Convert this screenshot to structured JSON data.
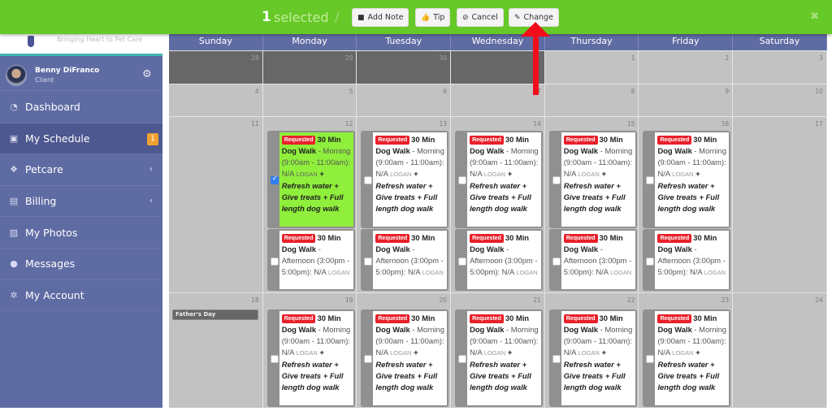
{
  "topbar": {
    "selected_count": "1",
    "selected_label": "selected",
    "separator": "/",
    "buttons": [
      {
        "label": "Add Note",
        "icon": "note-icon"
      },
      {
        "label": "Tip",
        "icon": "thumbs-up-icon"
      },
      {
        "label": "Cancel",
        "icon": "ban-icon"
      },
      {
        "label": "Change",
        "icon": "edit-icon"
      }
    ],
    "close_glyph": "✖"
  },
  "sidebar": {
    "tagline": "Bringing Heart to Pet Care",
    "user": {
      "name": "Benny DiFranco",
      "role": "Client"
    },
    "items": [
      {
        "label": "Dashboard",
        "icon": "dashboard-icon",
        "glyph": "◔"
      },
      {
        "label": "My Schedule",
        "icon": "calendar-icon",
        "glyph": "▣",
        "badge": "1",
        "active": true
      },
      {
        "label": "Petcare",
        "icon": "paw-icon",
        "glyph": "❖",
        "chevron": "‹"
      },
      {
        "label": "Billing",
        "icon": "file-icon",
        "glyph": "▤",
        "chevron": "‹"
      },
      {
        "label": "My Photos",
        "icon": "image-icon",
        "glyph": "▨"
      },
      {
        "label": "Messages",
        "icon": "comments-icon",
        "glyph": "●"
      },
      {
        "label": "My Account",
        "icon": "cogs-icon",
        "glyph": "✲"
      }
    ]
  },
  "calendar": {
    "weekdays": [
      "Sunday",
      "Monday",
      "Tuesday",
      "Wednesday",
      "Thursday",
      "Friday",
      "Saturday"
    ],
    "weeks": [
      {
        "days": [
          {
            "num": "28",
            "past": true
          },
          {
            "num": "29",
            "past": true
          },
          {
            "num": "30",
            "past": true
          },
          {
            "num": "",
            "past": true
          },
          {
            "num": "1"
          },
          {
            "num": "2"
          },
          {
            "num": "3"
          }
        ]
      },
      {
        "days": [
          {
            "num": "4"
          },
          {
            "num": "5"
          },
          {
            "num": "6"
          },
          {
            "num": "7"
          },
          {
            "num": "8"
          },
          {
            "num": "9"
          },
          {
            "num": "10"
          }
        ]
      },
      {
        "days": [
          {
            "num": "11"
          },
          {
            "num": "12"
          },
          {
            "num": "13"
          },
          {
            "num": "14"
          },
          {
            "num": "15"
          },
          {
            "num": "16"
          },
          {
            "num": "17"
          }
        ]
      },
      {
        "days": [
          {
            "num": "18",
            "holiday": "Father's Day"
          },
          {
            "num": "19"
          },
          {
            "num": "20"
          },
          {
            "num": "21"
          },
          {
            "num": "22"
          },
          {
            "num": "23"
          },
          {
            "num": "24"
          }
        ]
      }
    ],
    "event_templates": {
      "morning": {
        "status": "Requested",
        "service": "30 Min Dog Walk",
        "dash": " - ",
        "time": "Morning (9:00am - 11:00am): N/A",
        "walker": "LOGAN",
        "addons": "+ Refresh water + Give treats + Full length dog walk"
      },
      "afternoon": {
        "status": "Requested",
        "service": "30 Min Dog Walk",
        "dash": " - ",
        "time": "Afternoon (3:00pm - 5:00pm): N/A",
        "walker": "LOGAN",
        "addons": ""
      }
    },
    "events": [
      {
        "week": 2,
        "day": 1,
        "slot": "morning",
        "selected": true
      },
      {
        "week": 2,
        "day": 1,
        "slot": "afternoon",
        "selected": false
      },
      {
        "week": 2,
        "day": 2,
        "slot": "morning",
        "selected": false
      },
      {
        "week": 2,
        "day": 2,
        "slot": "afternoon",
        "selected": false
      },
      {
        "week": 2,
        "day": 3,
        "slot": "morning",
        "selected": false
      },
      {
        "week": 2,
        "day": 3,
        "slot": "afternoon",
        "selected": false
      },
      {
        "week": 2,
        "day": 4,
        "slot": "morning",
        "selected": false
      },
      {
        "week": 2,
        "day": 4,
        "slot": "afternoon",
        "selected": false
      },
      {
        "week": 2,
        "day": 5,
        "slot": "morning",
        "selected": false
      },
      {
        "week": 2,
        "day": 5,
        "slot": "afternoon",
        "selected": false
      },
      {
        "week": 3,
        "day": 1,
        "slot": "morning",
        "selected": false
      },
      {
        "week": 3,
        "day": 2,
        "slot": "morning",
        "selected": false
      },
      {
        "week": 3,
        "day": 3,
        "slot": "morning",
        "selected": false
      },
      {
        "week": 3,
        "day": 4,
        "slot": "morning",
        "selected": false
      },
      {
        "week": 3,
        "day": 5,
        "slot": "morning",
        "selected": false
      }
    ]
  },
  "colors": {
    "topbar": "#66c927",
    "sidebar": "#5f6ba3",
    "selected_event": "#8fef3c",
    "requested_tag": "#e8202a",
    "badge": "#f0a030",
    "annotation_arrow": "#f20d1b"
  }
}
